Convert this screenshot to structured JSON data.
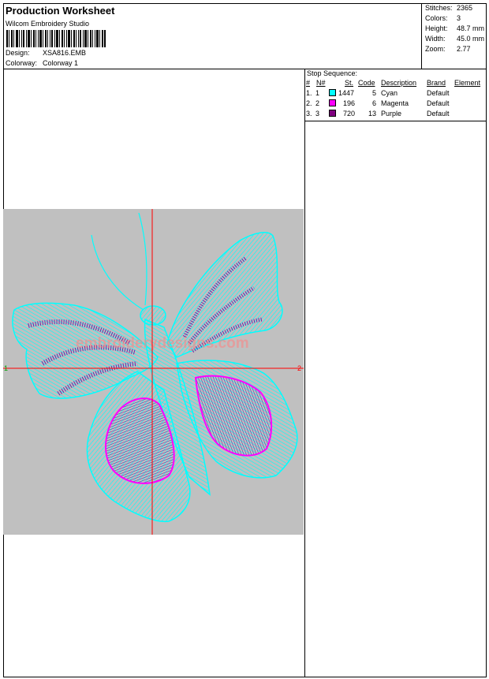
{
  "header": {
    "title": "Production Worksheet",
    "software": "Wilcom Embroidery Studio",
    "design_label": "Design:",
    "design_value": "XSA816.EMB",
    "colorway_label": "Colorway:",
    "colorway_value": "Colorway 1"
  },
  "stats": [
    {
      "label": "Stitches:",
      "value": "2365"
    },
    {
      "label": "Colors:",
      "value": "3"
    },
    {
      "label": "Height:",
      "value": "48.7 mm"
    },
    {
      "label": "Width:",
      "value": "45.0 mm"
    },
    {
      "label": "Zoom:",
      "value": "2.77"
    }
  ],
  "stop_sequence": {
    "title": "Stop Sequence:",
    "headers": {
      "index": "#",
      "n": "N#",
      "st": "St.",
      "code": "Code",
      "description": "Description",
      "brand": "Brand",
      "element": "Element"
    },
    "rows": [
      {
        "index": "1.",
        "n": "1",
        "color": "#00ffff",
        "st": "1447",
        "code": "5",
        "description": "Cyan",
        "brand": "Default"
      },
      {
        "index": "2.",
        "n": "2",
        "color": "#ff00ff",
        "st": "196",
        "code": "6",
        "description": "Magenta",
        "brand": "Default"
      },
      {
        "index": "3.",
        "n": "3",
        "color": "#800080",
        "st": "720",
        "code": "13",
        "description": "Purple",
        "brand": "Default"
      }
    ]
  },
  "canvas": {
    "axis_left_label": "1",
    "axis_right_label": "2",
    "watermark": "embroiderydesigns.com",
    "background_color": "#c0c0c0",
    "crosshair_color": "#ff0000",
    "thread_colors": {
      "cyan": "#00ffff",
      "magenta": "#ff00ff",
      "purple": "#7b1fa2"
    }
  }
}
